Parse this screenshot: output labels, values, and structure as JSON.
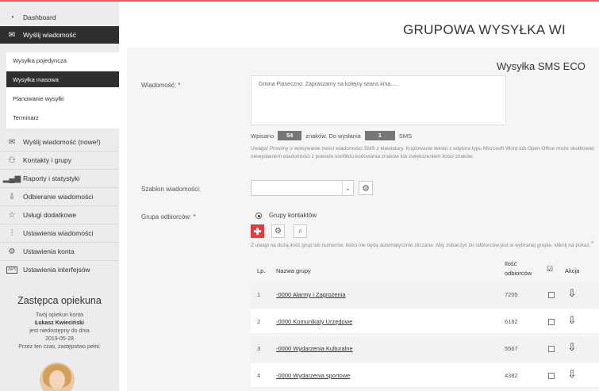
{
  "sidebar": {
    "items": [
      {
        "label": "Dashboard",
        "icon": "dashboard-icon"
      },
      {
        "label": "Wyślij wiadomość",
        "icon": "envelope-icon"
      },
      {
        "label": "Wyślij wiadomość (nowe!)",
        "icon": "envelope-icon"
      },
      {
        "label": "Kontakty i grupy",
        "icon": "contacts-icon"
      },
      {
        "label": "Raporty i statystyki",
        "icon": "bar-chart-icon"
      },
      {
        "label": "Odbieranie wiadomości",
        "icon": "download-icon"
      },
      {
        "label": "Usługi dodatkowe",
        "icon": "star-icon"
      },
      {
        "label": "Ustawienia wiadomości",
        "icon": "sliders-icon"
      },
      {
        "label": "Ustawienia konta",
        "icon": "gear-icon"
      },
      {
        "label": "Ustawienia interfejsów",
        "icon": "api-icon"
      }
    ],
    "submenu": [
      {
        "label": "Wysyłka pojedyncza"
      },
      {
        "label": "Wysyłka masowa"
      },
      {
        "label": "Planowanie wysyłki"
      },
      {
        "label": "Terminarz"
      }
    ],
    "deputy": {
      "title": "Zastępca opiekuna",
      "line1": "Twój opiekun konta",
      "name": "Łukasz Kwieciński",
      "line3": "jest niedostępny do dnia",
      "date": "2019-05-28",
      "line5": "Przez ten czas, zastępstwo pełni:"
    }
  },
  "main": {
    "title": "GRUPOWA WYSYŁKA WI",
    "subtitle": "Wysyłka SMS ECO",
    "message_label": "Wiadomość: *",
    "message_text": "Gmina Piaseczno: Zapraszamy na kolejny seans kina.....",
    "counter": {
      "prefix": "Wpisano",
      "chars": "54",
      "middle": "znaków. Do wysłania",
      "sms": "1",
      "suffix": "SMS"
    },
    "warning": "Uwaga! Prosimy o wpisywanie treści wiadomości SMS z klawiatury. Kopiowanie tekstu z edytora typu Microsoft Word lub Open Office może skutkować niewysłaniem wiadomości z powodu konfliktu kodowania znaków lub zwiększeniem ilości znaków.",
    "template_label": "Szablon wiadomości:",
    "recipients_label": "Grupa odbiorców: *",
    "radio_label": "Grupy kontaktów",
    "info_note": "Z uwagi na dużą ilość grup lub numerów, ilości nie będą automatycznie zliczane. Aby zobaczyć ilu odbiorców jest w wybranej grupie, kliknij na pokaż.",
    "table": {
      "headers": {
        "lp": "Lp.",
        "name": "Nazwa grupy",
        "count_line1": "Ilość",
        "count_line2": "odbiorców",
        "action": "Akcja"
      },
      "rows": [
        {
          "lp": "1",
          "name": "-0000 Alarmy i Zagrożenia",
          "count": "7205"
        },
        {
          "lp": "2",
          "name": "-0000 Komunikaty Urzędowe",
          "count": "6182"
        },
        {
          "lp": "3",
          "name": "-0000 Wydarzenia Kulturalne",
          "count": "5567"
        },
        {
          "lp": "4",
          "name": "-0000 Wydarzenia sportowe",
          "count": "4382"
        }
      ]
    }
  }
}
